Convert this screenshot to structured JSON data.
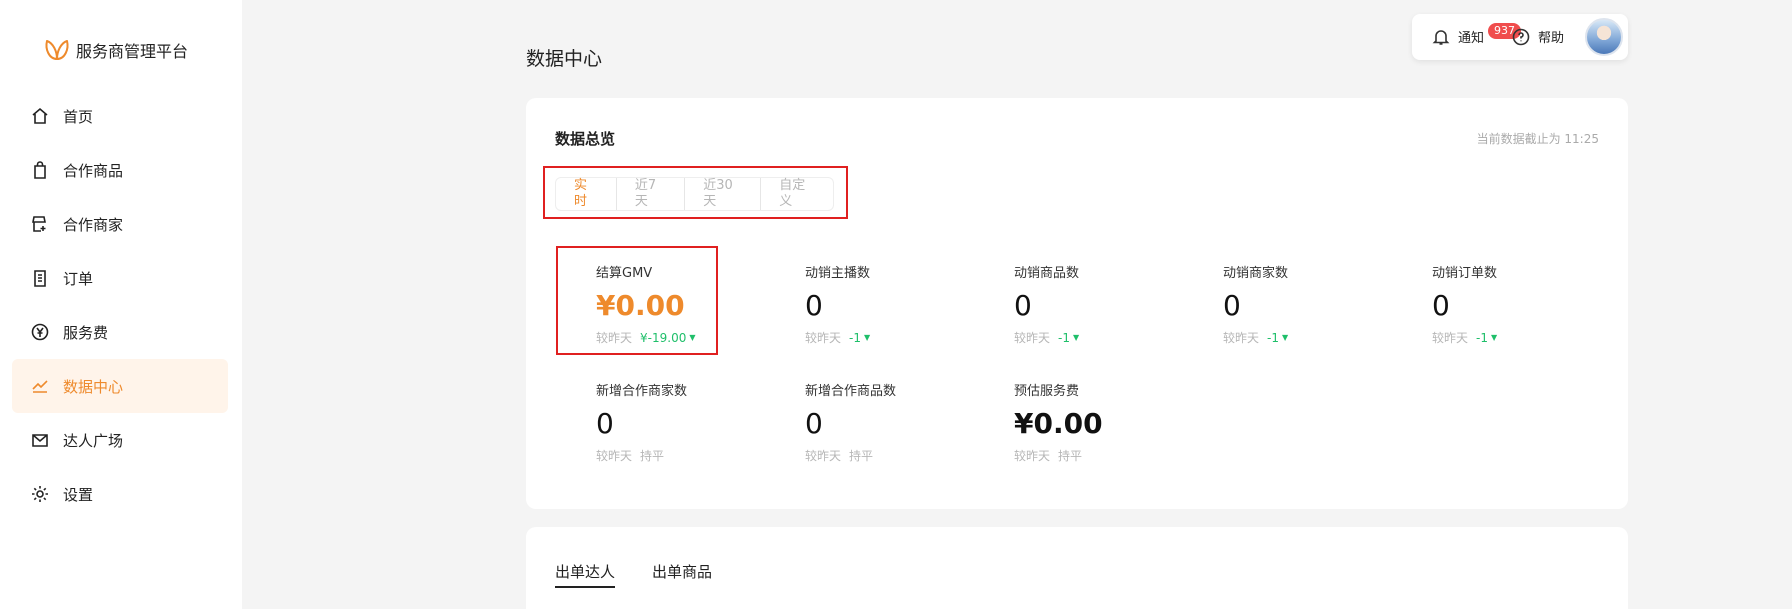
{
  "app": {
    "brand_name": "服务商管理平台"
  },
  "sidebar": {
    "items": [
      {
        "label": "首页",
        "icon": "home-icon"
      },
      {
        "label": "合作商品",
        "icon": "shopping-bag-icon"
      },
      {
        "label": "合作商家",
        "icon": "merchant-icon"
      },
      {
        "label": "订单",
        "icon": "order-icon"
      },
      {
        "label": "服务费",
        "icon": "yen-icon"
      },
      {
        "label": "数据中心",
        "icon": "chart-icon",
        "active": true
      },
      {
        "label": "达人广场",
        "icon": "mail-icon"
      },
      {
        "label": "设置",
        "icon": "gear-icon"
      }
    ]
  },
  "topbar": {
    "notice_label": "通知",
    "notice_badge": "937",
    "help_label": "帮助"
  },
  "page": {
    "title": "数据中心"
  },
  "overview": {
    "title": "数据总览",
    "update_time": "当前数据截止为 11:25",
    "time_tabs": [
      "实时",
      "近7天",
      "近30天",
      "自定义"
    ],
    "active_tab": "实时",
    "compare_label": "较昨天",
    "stats": [
      {
        "label": "结算GMV",
        "value": "¥0.00",
        "delta": "¥-19.00"
      },
      {
        "label": "动销主播数",
        "value": "0",
        "delta": "-1"
      },
      {
        "label": "动销商品数",
        "value": "0",
        "delta": "-1"
      },
      {
        "label": "动销商家数",
        "value": "0",
        "delta": "-1"
      },
      {
        "label": "动销订单数",
        "value": "0",
        "delta": "-1"
      },
      {
        "label": "新增合作商家数",
        "value": "0",
        "delta": "持平"
      },
      {
        "label": "新增合作商品数",
        "value": "0",
        "delta": "持平"
      },
      {
        "label": "预估服务费",
        "value": "¥0.00",
        "delta": "持平"
      }
    ]
  },
  "bottom_tabs": [
    "出单达人",
    "出单商品"
  ],
  "colors": {
    "accent": "#ee8a2c",
    "up_green": "#1fbf6a",
    "highlight_red": "#e02020"
  }
}
